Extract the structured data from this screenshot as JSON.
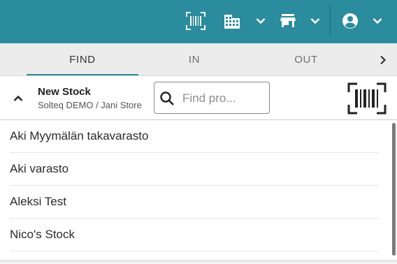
{
  "colors": {
    "primary": "#2a8c9c",
    "tab_bg": "#ececec",
    "accent_indicator": "#2a8c9c"
  },
  "topbar": {
    "icons": [
      "barcode-scan-icon",
      "business-icon",
      "chevron-down-icon",
      "store-icon",
      "chevron-down-icon",
      "account-circle-icon",
      "chevron-down-icon"
    ]
  },
  "tabs": [
    {
      "label": "FIND",
      "active": true
    },
    {
      "label": "IN",
      "active": false
    },
    {
      "label": "OUT",
      "active": false
    }
  ],
  "stock": {
    "title": "New Stock",
    "subtitle": "Solteq DEMO / Jani Store"
  },
  "search": {
    "placeholder": "Find pro...",
    "value": ""
  },
  "list": {
    "items": [
      "Aki Myymälän takavarasto",
      "Aki varasto",
      "Aleksi Test",
      "Nico's Stock"
    ]
  }
}
